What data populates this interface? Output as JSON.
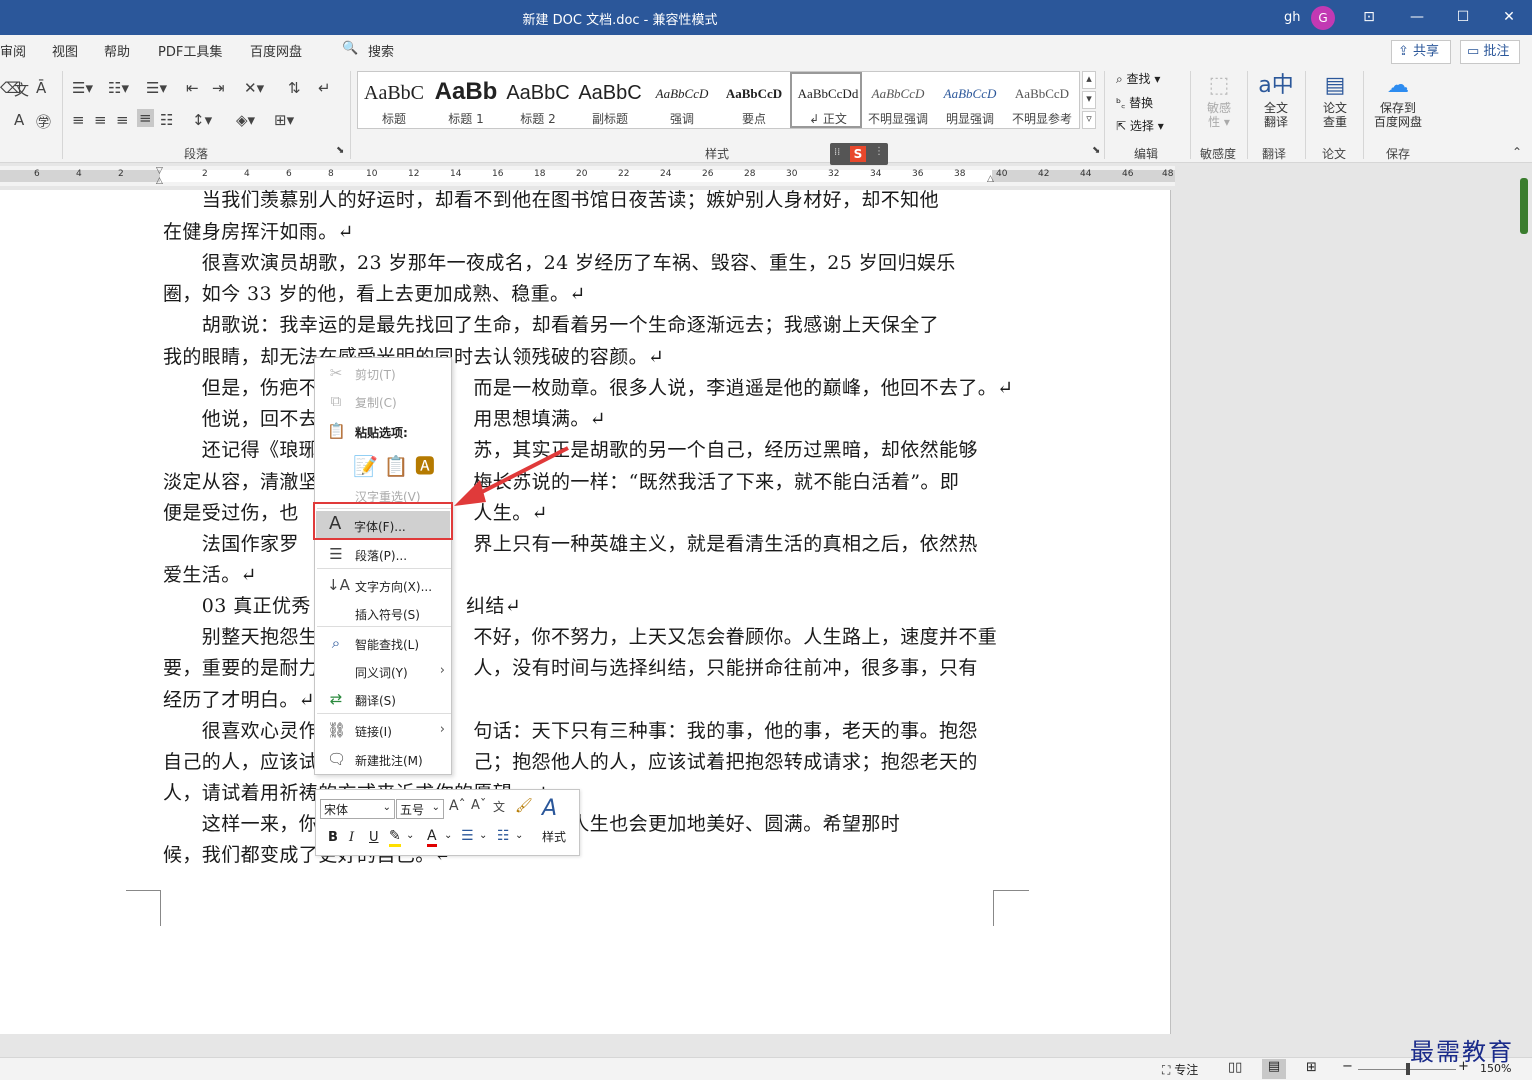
{
  "titlebar": {
    "title": "新建 DOC 文档.doc  -  兼容性模式",
    "user": "gh",
    "avatar": "G",
    "win_mode": "⊡",
    "win_min": "—",
    "win_max": "☐",
    "win_close": "✕"
  },
  "menu": {
    "items": [
      "审阅",
      "视图",
      "帮助",
      "PDF工具集",
      "百度网盘"
    ],
    "search_icon": "🔍",
    "search": "搜索",
    "share": "共享",
    "comment": "批注"
  },
  "ribbon": {
    "groups": {
      "paragraph": "段落",
      "styles": "样式",
      "edit": "编辑",
      "sensitivity": "敏感度",
      "translate": "翻译",
      "paper": "论文",
      "save": "保存"
    },
    "styles": [
      {
        "preview": "AaBbC",
        "label": "标题"
      },
      {
        "preview": "AaBb",
        "label": "标题 1"
      },
      {
        "preview": "AaBbC",
        "label": "标题 2"
      },
      {
        "preview": "AaBbC",
        "label": "副标题"
      },
      {
        "preview": "AaBbCcD",
        "label": "强调"
      },
      {
        "preview": "AaBbCcD",
        "label": "要点"
      },
      {
        "preview": "AaBbCcDd",
        "label": "↲ 正文"
      },
      {
        "preview": "AaBbCcD",
        "label": "不明显强调"
      },
      {
        "preview": "AaBbCcD",
        "label": "明显强调"
      },
      {
        "preview": "AaBbCcD",
        "label": "不明显参考"
      }
    ],
    "edit": {
      "find": "查找",
      "replace": "替换",
      "select": "选择"
    },
    "sens": {
      "l1": "敏感",
      "l2": "性 ▾"
    },
    "trans": {
      "l1": "全文",
      "l2": "翻译"
    },
    "paper": {
      "l1": "论文",
      "l2": "查重"
    },
    "baidu": {
      "l1": "保存到",
      "l2": "百度网盘"
    }
  },
  "ruler": {
    "numbers": [
      "6",
      "4",
      "2",
      "2",
      "4",
      "6",
      "8",
      "10",
      "12",
      "14",
      "16",
      "18",
      "20",
      "22",
      "24",
      "26",
      "28",
      "30",
      "32",
      "34",
      "36",
      "38",
      "40",
      "42",
      "44",
      "46",
      "48"
    ]
  },
  "document": {
    "lines": [
      "　　当我们羡慕别人的好运时，却看不到他在图书馆日夜苦读；嫉妒别人身材好，却不知他",
      "在健身房挥汗如雨。↵",
      "　　很喜欢演员胡歌，23 岁那年一夜成名，24 岁经历了车祸、毁容、重生，25 岁回归娱乐",
      "圈，如今 33 岁的他，看上去更加成熟、稳重。↵",
      "　　胡歌说：我幸运的是最先找回了生命，却看着另一个生命逐渐远去；我感谢上天保全了",
      "我的眼睛，却无法在感受光明的同时去认领残破的容颜。↵",
      "　　但是，伤疤不　　　　　　　　而是一枚勋章。很多人说，李逍遥是他的巅峰，他回不去了。↵",
      "　　他说，回不去　　　　　　　　用思想填满。↵",
      "　　还记得《琅琊　　　　　　　　苏，其实正是胡歌的另一个自己，经历过黑暗，却依然能够",
      "淡定从容，清澈坚　　　　　　　　梅长苏说的一样：“既然我活了下来，就不能白活着”。即",
      "便是受过伤，也　　　　　　　　　人生。↵",
      "　　法国作家罗　　　　　　　　　界上只有一种英雄主义，就是看清生活的真相之后，依然热",
      "爱生活。↵",
      "　　03  真正优秀　　　　　　　　纠结↵",
      "　　别整天抱怨生　　　　　　　　不好，你不努力，上天又怎会眷顾你。人生路上，速度并不重",
      "要，重要的是耐力　　　　　　　　人，没有时间与选择纠结，只能拼命往前冲，很多事，只有",
      "经历了才明白。↵",
      "　　很喜欢心灵作　　　　　　　　句话：天下只有三种事：我的事，他的事，老天的事。抱怨",
      "自己的人，应该试　　　　　　　　己；抱怨他人的人，应该试着把抱怨转成请求；抱怨老天的",
      "人，请试着用祈祷的方式来诉求你的愿望。↵",
      "　　这样一来，你　　　　　　　　　　，你的人生也会更加地美好、圆满。希望那时",
      "候，我们都变成了更好的自己。↵"
    ]
  },
  "context_menu": {
    "cut": "剪切(T)",
    "copy": "复制(C)",
    "paste_options": "粘贴选项:",
    "hanzi": "汉字重选(V)",
    "font": "字体(F)...",
    "paragraph": "段落(P)...",
    "text_direction": "文字方向(X)...",
    "insert_symbol": "插入符号(S)",
    "smart_lookup": "智能查找(L)",
    "synonyms": "同义词(Y)",
    "translate": "翻译(S)",
    "link": "链接(I)",
    "new_comment": "新建批注(M)"
  },
  "mini_toolbar": {
    "font": "宋体",
    "size": "五号",
    "styles": "样式",
    "bold": "B",
    "italic": "I",
    "underline": "U"
  },
  "status": {
    "focus": "专注",
    "zoom": "150%"
  },
  "watermark": "最需教育",
  "colors": {
    "accent": "#2b579a",
    "highlight_box": "#e03a3a",
    "avatar": "#c239b3"
  }
}
